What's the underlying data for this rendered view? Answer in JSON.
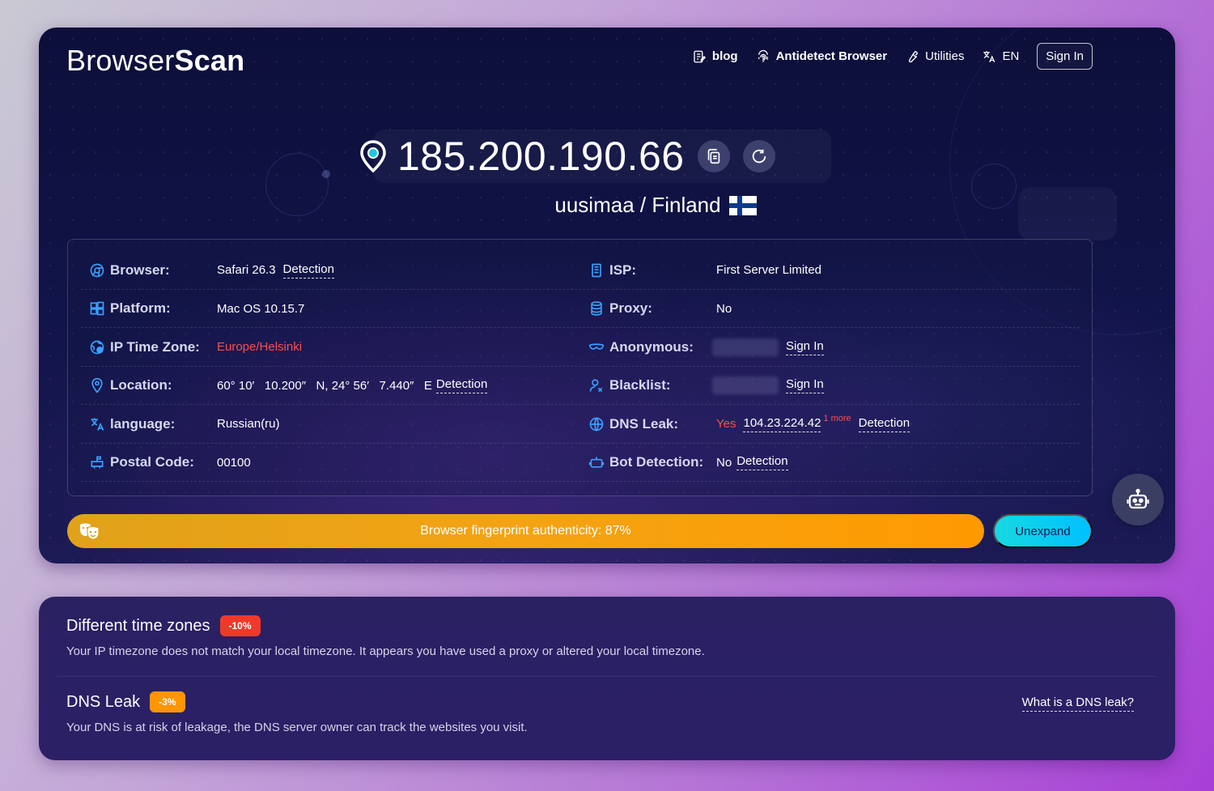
{
  "header": {
    "logo_regular": "Browser",
    "logo_bold": "Scan",
    "nav": [
      {
        "label": "blog",
        "icon": "document-edit-icon"
      },
      {
        "label": "Antidetect Browser",
        "icon": "fingerprint-icon"
      },
      {
        "label": "Utilities",
        "icon": "wrench-icon"
      },
      {
        "label": "EN",
        "icon": "translate-icon"
      }
    ],
    "signin_label": "Sign In"
  },
  "ip": {
    "address": "185.200.190.66",
    "region": "uusimaa / Finland"
  },
  "info": {
    "left": [
      {
        "label": "Browser:",
        "value": "Safari 26.3",
        "link": "Detection"
      },
      {
        "label": "Platform:",
        "value": "Mac OS 10.15.7"
      },
      {
        "label": "IP Time Zone:",
        "value": "Europe/Helsinki"
      },
      {
        "label": "Location:",
        "value": "60° 10′   10.200″   N, 24° 56′   7.440″   E",
        "link": "Detection"
      },
      {
        "label": "language:",
        "value": "Russian(ru)"
      },
      {
        "label": "Postal Code:",
        "value": "00100"
      }
    ],
    "right": [
      {
        "label": "ISP:",
        "value": "First Server Limited"
      },
      {
        "label": "Proxy:",
        "value": "No"
      },
      {
        "label": "Anonymous:",
        "link": "Sign In"
      },
      {
        "label": "Blacklist:",
        "link": "Sign In"
      },
      {
        "label": "DNS Leak:",
        "status": "Yes",
        "value": "104.23.224.42",
        "count": "1",
        "more": "more",
        "link": "Detection"
      },
      {
        "label": "Bot Detection:",
        "value": "No",
        "link": "Detection"
      }
    ]
  },
  "authenticity": {
    "label": "Browser fingerprint authenticity: 87%",
    "percent": 87
  },
  "unexpand_label": "Unexpand",
  "issues": [
    {
      "title": "Different time zones",
      "badge": "-10%",
      "badge_color": "#f0392b",
      "description": "Your IP timezone does not match your local timezone. It appears you have used a proxy or altered your local timezone."
    },
    {
      "title": "DNS Leak",
      "badge": "-3%",
      "badge_color": "#ff9500",
      "description": "Your DNS is at risk of leakage, the DNS server owner can track the websites you visit.",
      "link": "What is a DNS leak?"
    }
  ],
  "colors": {
    "accent_red": "#ff4d4d",
    "bar_orange": "#f4a313",
    "button_cyan": "#17d9e0"
  }
}
